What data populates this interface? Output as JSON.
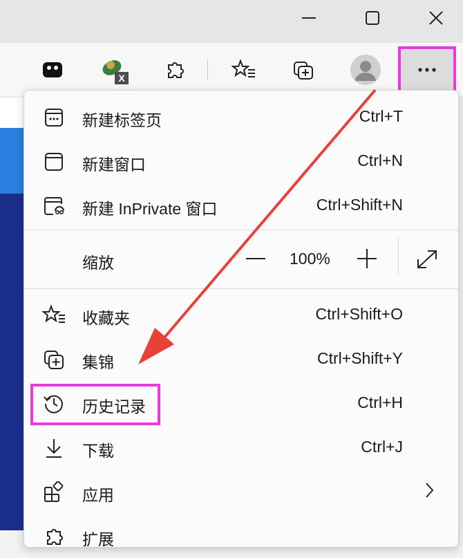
{
  "titlebar": {
    "minimize": "minimize",
    "maximize": "maximize",
    "close": "close"
  },
  "toolbar": {
    "icons": [
      "game-icon",
      "extension-x-icon",
      "extensions-icon",
      "favorites-icon",
      "collections-icon",
      "profile-icon"
    ],
    "more_button": "more-icon"
  },
  "menu": {
    "items": [
      {
        "label": "新建标签页",
        "shortcut": "Ctrl+T",
        "icon": "new-tab-icon"
      },
      {
        "label": "新建窗口",
        "shortcut": "Ctrl+N",
        "icon": "new-window-icon"
      },
      {
        "label": "新建 InPrivate 窗口",
        "shortcut": "Ctrl+Shift+N",
        "icon": "inprivate-icon"
      }
    ],
    "zoom": {
      "label": "缩放",
      "minus": "—",
      "value": "100%",
      "plus": "+"
    },
    "items2": [
      {
        "label": "收藏夹",
        "shortcut": "Ctrl+Shift+O",
        "icon": "favorites-icon"
      },
      {
        "label": "集锦",
        "shortcut": "Ctrl+Shift+Y",
        "icon": "collections-icon"
      },
      {
        "label": "历史记录",
        "shortcut": "Ctrl+H",
        "icon": "history-icon"
      },
      {
        "label": "下载",
        "shortcut": "Ctrl+J",
        "icon": "download-icon"
      },
      {
        "label": "应用",
        "shortcut": "",
        "icon": "apps-icon"
      },
      {
        "label": "扩展",
        "shortcut": "",
        "icon": "extensions-icon"
      }
    ]
  },
  "colors": {
    "highlight": "#e83bd8",
    "arrow": "#e8413a"
  }
}
